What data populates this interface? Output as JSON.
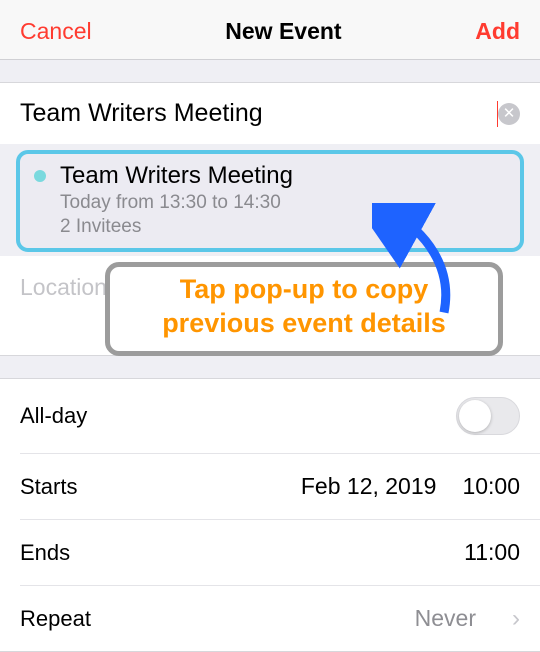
{
  "nav": {
    "cancel": "Cancel",
    "title": "New Event",
    "add": "Add"
  },
  "event": {
    "title_value": "Team Writers Meeting",
    "location_placeholder": "Location"
  },
  "suggestion": {
    "title": "Team Writers Meeting",
    "subtitle": "Today from 13:30 to 14:30",
    "invitees": "2 Invitees"
  },
  "callout": {
    "line1": "Tap pop-up to copy",
    "line2": "previous event details"
  },
  "rows": {
    "allday_label": "All-day",
    "allday_on": false,
    "starts_label": "Starts",
    "starts_date": "Feb 12, 2019",
    "starts_time": "10:00",
    "ends_label": "Ends",
    "ends_time": "11:00",
    "repeat_label": "Repeat",
    "repeat_value": "Never"
  }
}
